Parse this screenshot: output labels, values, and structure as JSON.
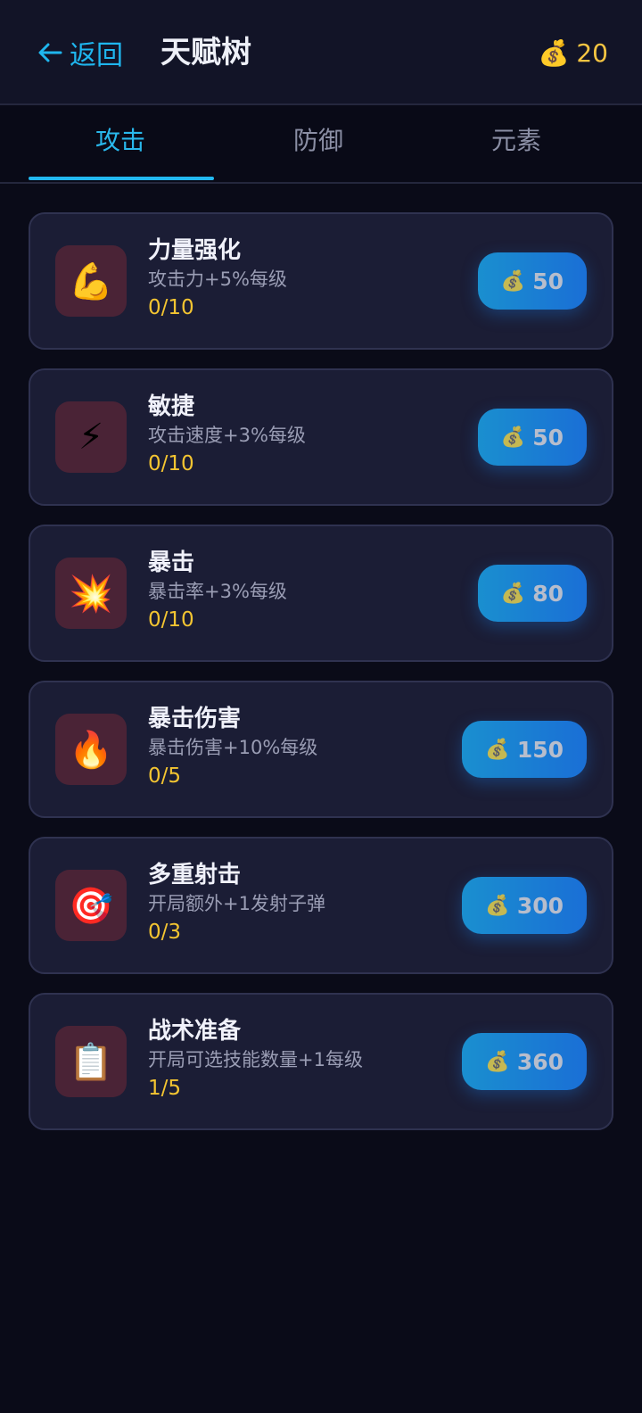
{
  "header": {
    "back_label": "返回",
    "title": "天赋树",
    "coins": "20",
    "coin_icon": "money-bag-icon"
  },
  "tabs": [
    {
      "label": "攻击",
      "active": true
    },
    {
      "label": "防御",
      "active": false
    },
    {
      "label": "元素",
      "active": false
    }
  ],
  "accent_color": "#22b8f0",
  "talents": [
    {
      "icon": "💪",
      "icon_name": "flexed-biceps-icon",
      "name": "力量强化",
      "desc": "攻击力+5%每级",
      "level": "0/10",
      "cost": "50"
    },
    {
      "icon": "⚡",
      "icon_name": "lightning-icon",
      "name": "敏捷",
      "desc": "攻击速度+3%每级",
      "level": "0/10",
      "cost": "50"
    },
    {
      "icon": "💥",
      "icon_name": "explosion-icon",
      "name": "暴击",
      "desc": "暴击率+3%每级",
      "level": "0/10",
      "cost": "80"
    },
    {
      "icon": "🔥",
      "icon_name": "fire-icon",
      "name": "暴击伤害",
      "desc": "暴击伤害+10%每级",
      "level": "0/5",
      "cost": "150"
    },
    {
      "icon": "🎯",
      "icon_name": "target-icon",
      "name": "多重射击",
      "desc": "开局额外+1发射子弹",
      "level": "0/3",
      "cost": "300"
    },
    {
      "icon": "📋",
      "icon_name": "clipboard-icon",
      "name": "战术准备",
      "desc": "开局可选技能数量+1每级",
      "level": "1/5",
      "cost": "360"
    }
  ]
}
